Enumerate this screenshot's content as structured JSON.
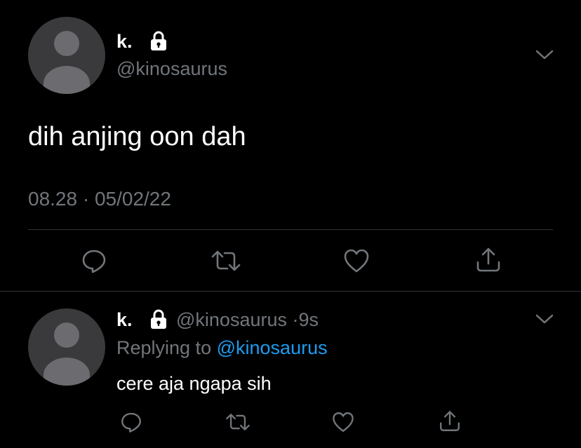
{
  "main_tweet": {
    "display_name": "k.",
    "handle": "@kinosaurus",
    "text": "dih anjing oon dah",
    "timestamp": "08.28 · 05/02/22",
    "icons": {
      "avatar": "default-avatar",
      "protected": "lock-icon",
      "more": "chevron-down-icon",
      "actions": [
        "reply-icon",
        "retweet-icon",
        "like-icon",
        "share-icon"
      ]
    }
  },
  "reply_tweet": {
    "display_name": "k.",
    "handle": "@kinosaurus",
    "separator": "·",
    "time_ago": "9s",
    "replying_prefix": "Replying to",
    "replying_handle": "@kinosaurus",
    "text": "cere aja ngapa sih",
    "icons": {
      "avatar": "default-avatar",
      "protected": "lock-icon",
      "more": "chevron-down-icon",
      "actions": [
        "reply-icon",
        "retweet-icon",
        "like-icon",
        "share-icon"
      ]
    }
  },
  "colors": {
    "background": "#000000",
    "text": "#ffffff",
    "muted": "#71767b",
    "link": "#1d9bf0",
    "divider": "#2f3336"
  }
}
